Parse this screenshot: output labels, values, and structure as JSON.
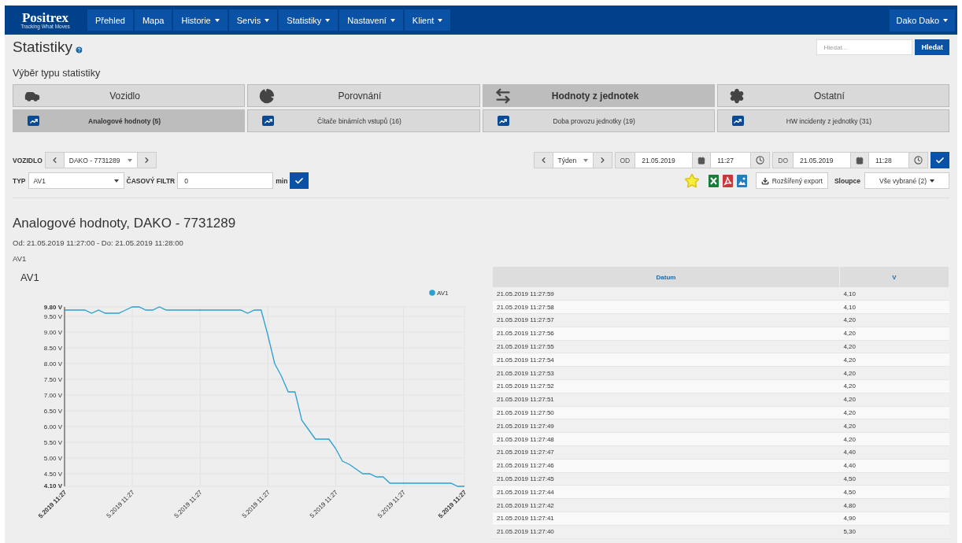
{
  "nav": {
    "logo": {
      "name": "Positrex",
      "tagline": "Tracking What Moves"
    },
    "items": [
      {
        "label": "Přehled",
        "dropdown": false
      },
      {
        "label": "Mapa",
        "dropdown": false
      },
      {
        "label": "Historie",
        "dropdown": true
      },
      {
        "label": "Servis",
        "dropdown": true
      },
      {
        "label": "Statistiky",
        "dropdown": true
      },
      {
        "label": "Nastavení",
        "dropdown": true
      },
      {
        "label": "Klient",
        "dropdown": true
      }
    ],
    "user": "Dako Dako"
  },
  "page": {
    "title": "Statistiky"
  },
  "search": {
    "placeholder": "Hledat...",
    "button": "Hledat"
  },
  "section_label": "Výběr typu statistiky",
  "categories": [
    {
      "label": "Vozidlo",
      "selected": false
    },
    {
      "label": "Porovnání",
      "selected": false
    },
    {
      "label": "Hodnoty z jednotek",
      "selected": true
    },
    {
      "label": "Ostatní",
      "selected": false
    }
  ],
  "subcategories": [
    {
      "label": "Analogové hodnoty (5)",
      "selected": true
    },
    {
      "label": "Čítače binárních vstupů (16)",
      "selected": false
    },
    {
      "label": "Doba provozu jednotky (19)",
      "selected": false
    },
    {
      "label": "HW incidenty z jednotky (31)",
      "selected": false
    }
  ],
  "vehicle_filter": {
    "label": "VOZIDLO",
    "value": "DAKO - 7731289"
  },
  "type_filter": {
    "label": "TYP",
    "value": "AV1"
  },
  "time_filter": {
    "label": "ČASOVÝ FILTR",
    "value": "0",
    "unit": "min"
  },
  "period": {
    "value": "Týden"
  },
  "from": {
    "label": "OD",
    "date": "21.05.2019",
    "time": "11:27"
  },
  "to": {
    "label": "DO",
    "date": "21.05.2019",
    "time": "11:28"
  },
  "export": {
    "label": "Rozšířený export"
  },
  "columns_select": {
    "label": "Sloupce",
    "value": "Vše vybrané (2)"
  },
  "report": {
    "title": "Analogové hodnoty, DAKO - 7731289",
    "range": "Od: 21.05.2019 11:27:00 - Do: 21.05.2019 11:28:00",
    "channel": "AV1"
  },
  "chart": {
    "title": "AV1",
    "chart_data": {
      "type": "line",
      "categories": [
        "5.2019 11:27",
        null,
        null,
        null,
        null,
        null,
        null,
        null,
        null,
        null,
        "5.2019 11:27",
        null,
        null,
        null,
        null,
        null,
        null,
        null,
        null,
        null,
        "5.2019 11:27",
        null,
        null,
        null,
        null,
        null,
        null,
        null,
        null,
        null,
        "5.2019 11:27",
        null,
        null,
        null,
        null,
        null,
        null,
        null,
        null,
        null,
        "5.2019 11:27",
        null,
        null,
        null,
        null,
        null,
        null,
        null,
        null,
        null,
        "5.2019 11:27",
        null,
        null,
        null,
        null,
        null,
        null,
        null,
        null,
        "5.2019 11:27"
      ],
      "series": [
        {
          "name": "AV1",
          "color": "#29a0d0",
          "values": [
            9.7,
            9.7,
            9.7,
            9.7,
            9.6,
            9.7,
            9.6,
            9.6,
            9.6,
            9.7,
            9.8,
            9.8,
            9.7,
            9.7,
            9.8,
            9.7,
            9.7,
            9.7,
            9.7,
            9.7,
            9.7,
            9.7,
            9.7,
            9.7,
            9.7,
            9.7,
            9.7,
            9.6,
            9.7,
            9.7,
            8.9,
            8.0,
            7.6,
            7.1,
            7.1,
            6.2,
            5.9,
            5.6,
            5.6,
            5.6,
            5.3,
            4.9,
            4.8,
            4.65,
            4.5,
            4.5,
            4.4,
            4.4,
            4.2,
            4.2,
            4.2,
            4.2,
            4.2,
            4.2,
            4.2,
            4.2,
            4.2,
            4.2,
            4.1,
            4.1
          ]
        }
      ],
      "yticks": [
        {
          "value": 4.1,
          "label": "4.10 V"
        },
        {
          "value": 4.5,
          "label": "4.50 V"
        },
        {
          "value": 5.0,
          "label": "5.00 V"
        },
        {
          "value": 5.5,
          "label": "5.50 V"
        },
        {
          "value": 6.0,
          "label": "6.00 V"
        },
        {
          "value": 6.5,
          "label": "6.50 V"
        },
        {
          "value": 7.0,
          "label": "7.00 V"
        },
        {
          "value": 7.5,
          "label": "7.50 V"
        },
        {
          "value": 8.0,
          "label": "8.00 V"
        },
        {
          "value": 8.5,
          "label": "8.50 V"
        },
        {
          "value": 9.0,
          "label": "9.00 V"
        },
        {
          "value": 9.5,
          "label": "9.50 V"
        },
        {
          "value": 9.8,
          "label": "9.80 V"
        }
      ],
      "ylim": [
        4.1,
        9.8
      ],
      "grid": true
    }
  },
  "table": {
    "columns": [
      "Datum",
      "V"
    ],
    "rows": [
      [
        "21.05.2019 11:27:59",
        "4,10"
      ],
      [
        "21.05.2019 11:27:58",
        "4,10"
      ],
      [
        "21.05.2019 11:27:57",
        "4,20"
      ],
      [
        "21.05.2019 11:27:56",
        "4,20"
      ],
      [
        "21.05.2019 11:27:55",
        "4,20"
      ],
      [
        "21.05.2019 11:27:54",
        "4,20"
      ],
      [
        "21.05.2019 11:27:53",
        "4,20"
      ],
      [
        "21.05.2019 11:27:52",
        "4,20"
      ],
      [
        "21.05.2019 11:27:51",
        "4,20"
      ],
      [
        "21.05.2019 11:27:50",
        "4,20"
      ],
      [
        "21.05.2019 11:27:49",
        "4,20"
      ],
      [
        "21.05.2019 11:27:48",
        "4,20"
      ],
      [
        "21.05.2019 11:27:47",
        "4,40"
      ],
      [
        "21.05.2019 11:27:46",
        "4,40"
      ],
      [
        "21.05.2019 11:27:45",
        "4,50"
      ],
      [
        "21.05.2019 11:27:44",
        "4,50"
      ],
      [
        "21.05.2019 11:27:42",
        "4,80"
      ],
      [
        "21.05.2019 11:27:41",
        "4,90"
      ],
      [
        "21.05.2019 11:27:40",
        "5,30"
      ]
    ]
  }
}
